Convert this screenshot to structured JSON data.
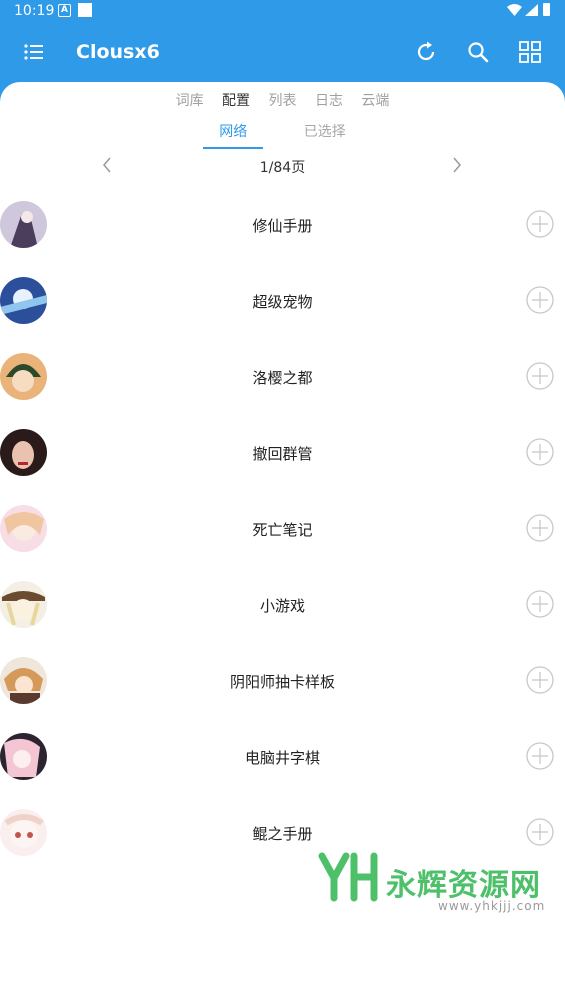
{
  "status_bar": {
    "time": "10:19",
    "notif_icon": "A"
  },
  "app_bar": {
    "title": "Clousx6"
  },
  "tabs": [
    {
      "label": "词库",
      "active": false
    },
    {
      "label": "配置",
      "active": true
    },
    {
      "label": "列表",
      "active": false
    },
    {
      "label": "日志",
      "active": false
    },
    {
      "label": "云端",
      "active": false
    }
  ],
  "subtabs": [
    {
      "label": "网络",
      "active": true
    },
    {
      "label": "已选择",
      "active": false
    }
  ],
  "pager": {
    "label": "1/84页"
  },
  "items": [
    {
      "name": "修仙手册"
    },
    {
      "name": "超级宠物"
    },
    {
      "name": "洛樱之都"
    },
    {
      "name": "撤回群管"
    },
    {
      "name": "死亡笔记"
    },
    {
      "name": "小游戏"
    },
    {
      "name": "阴阳师抽卡样板"
    },
    {
      "name": "电脑井字棋"
    },
    {
      "name": "鲲之手册"
    }
  ],
  "watermark": {
    "text": "永辉资源网",
    "url": "www.yhkjjj.com"
  },
  "colors": {
    "primary": "#2f9be8",
    "watermark": "#4fc06a"
  }
}
